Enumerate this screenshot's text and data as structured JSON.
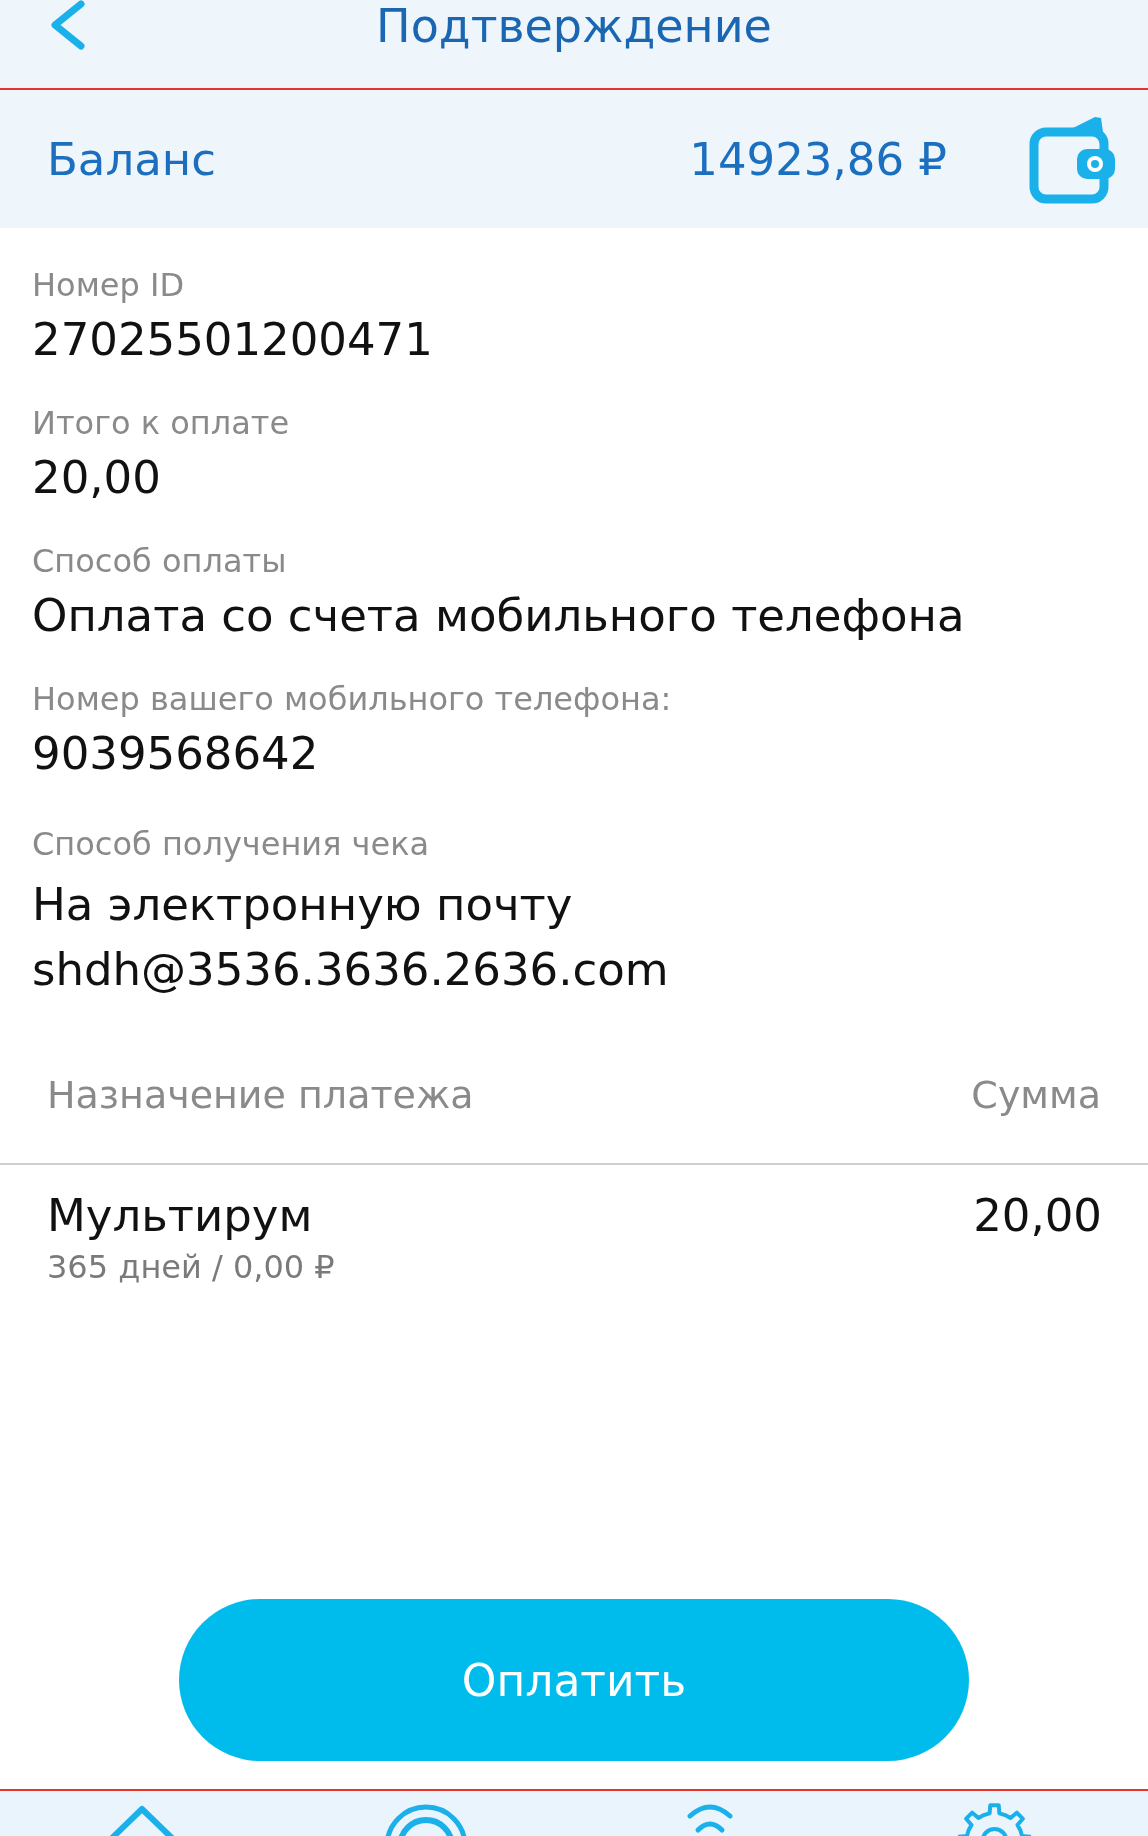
{
  "header": {
    "title": "Подтверждение"
  },
  "balance": {
    "label": "Баланс",
    "amount": "14923,86 ₽"
  },
  "fields": [
    {
      "label": "Номер ID",
      "values": [
        "27025501200471"
      ]
    },
    {
      "label": "Итого к оплате",
      "values": [
        "20,00"
      ]
    },
    {
      "label": "Способ оплаты",
      "values": [
        "Оплата со счета мобильного телефона"
      ]
    },
    {
      "label": "Номер вашего мобильного телефона:",
      "values": [
        "9039568642"
      ]
    },
    {
      "label": "Способ получения чека",
      "values": [
        "На электронную почту",
        "shdh@3536.3636.2636.com"
      ]
    }
  ],
  "table": {
    "columns": [
      "Назначение платежа",
      "Сумма"
    ],
    "rows": [
      {
        "name": "Мультирум",
        "details": "365 дней / 0,00 ₽",
        "amount": "20,00"
      }
    ]
  },
  "pay_button": {
    "label": "Оплатить"
  }
}
